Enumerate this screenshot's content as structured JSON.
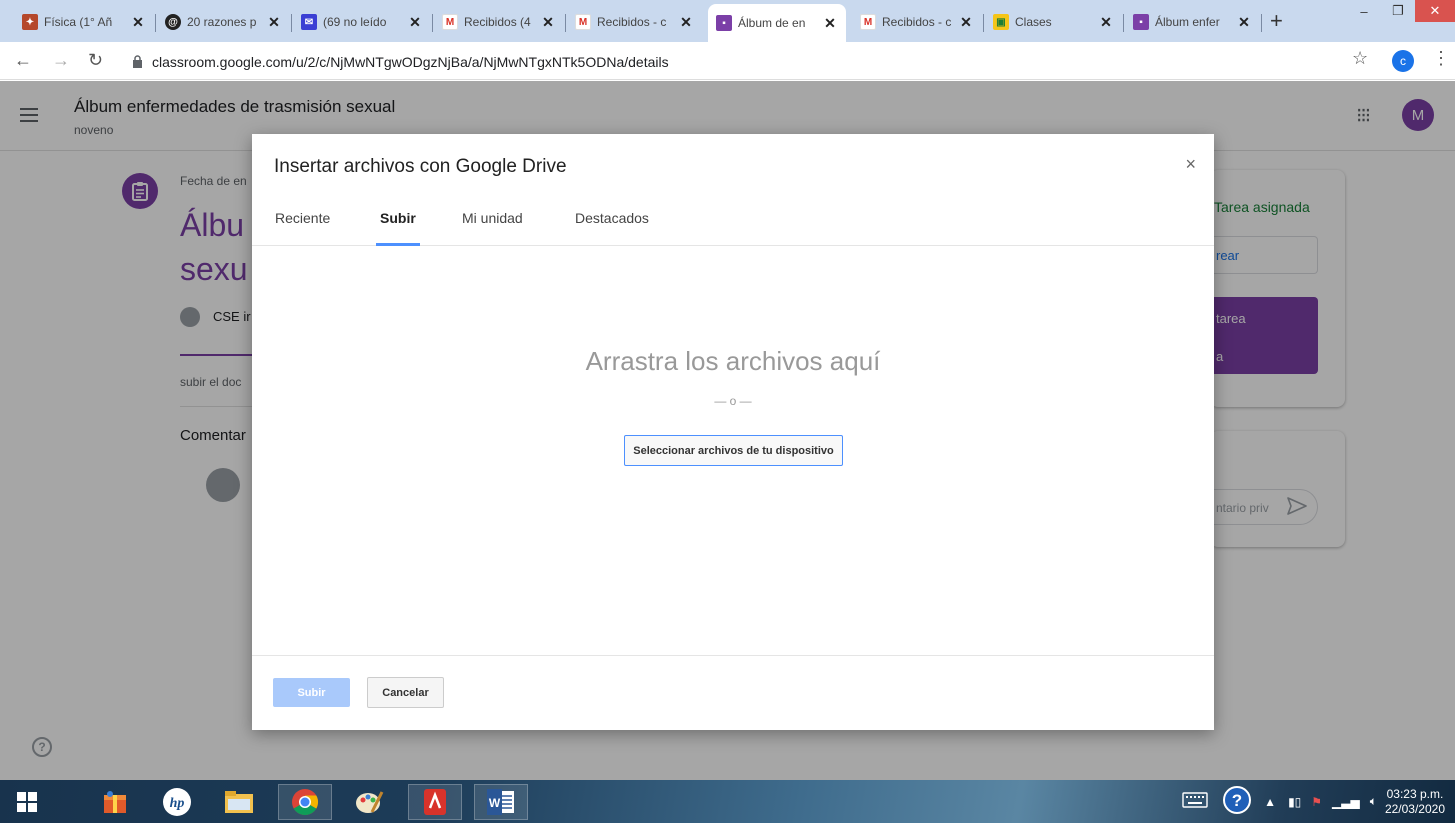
{
  "browser": {
    "tabs": [
      {
        "title": "Física (1° Añ",
        "icon": "school-favicon",
        "active": false
      },
      {
        "title": "20 razones p",
        "icon": "swirl-favicon",
        "active": false
      },
      {
        "title": "(69 no leído",
        "icon": "mail-favicon",
        "active": false
      },
      {
        "title": "Recibidos (4",
        "icon": "gmail-favicon",
        "active": false
      },
      {
        "title": "Recibidos - c",
        "icon": "gmail-favicon",
        "active": false
      },
      {
        "title": "Álbum de en",
        "icon": "classroom-assignment-favicon",
        "active": true
      },
      {
        "title": "Recibidos - c",
        "icon": "gmail-favicon",
        "active": false
      },
      {
        "title": "Clases",
        "icon": "classroom-favicon",
        "active": false
      },
      {
        "title": "Álbum enfer",
        "icon": "classroom-assignment-favicon",
        "active": false
      }
    ],
    "new_tab": "+",
    "url": "classroom.google.com/u/2/c/NjMwNTgwODgzNjBa/a/NjMwNTgxNTk5ODNa/details",
    "profile_initial": "c"
  },
  "classroom": {
    "course_title": "Álbum enfermedades de trasmisión sexual",
    "course_section": "noveno",
    "user_initial": "M",
    "assignment": {
      "due_label": "Fecha de en",
      "title": "Álbu sexu",
      "teacher": "CSE ir",
      "instructions": "subir el doc",
      "comments_heading": "Comentar"
    },
    "work_card": {
      "status": "Tarea asignada",
      "create_label": "rear",
      "mark_done_line1": "tarea",
      "mark_done_line2": "a"
    },
    "private_comment_placeholder": "ntario priv"
  },
  "dialog": {
    "title": "Insertar archivos con Google Drive",
    "close": "×",
    "tabs": [
      "Reciente",
      "Subir",
      "Mi unidad",
      "Destacados"
    ],
    "selected_tab": "Subir",
    "drop_text": "Arrastra los archivos aquí",
    "or_text": "— o —",
    "select_button": "Seleccionar archivos de tu dispositivo",
    "upload_button": "Subir",
    "cancel_button": "Cancelar"
  },
  "taskbar": {
    "apps": [
      "windows-start",
      "app-gift",
      "hp",
      "file-explorer",
      "chrome",
      "paint",
      "acrobat",
      "word"
    ],
    "time": "03:23 p.m.",
    "date": "22/03/2020"
  },
  "colors": {
    "classroom_purple": "#7b3fa7",
    "drive_blue": "#4d90fe",
    "assigned_green": "#188038"
  }
}
